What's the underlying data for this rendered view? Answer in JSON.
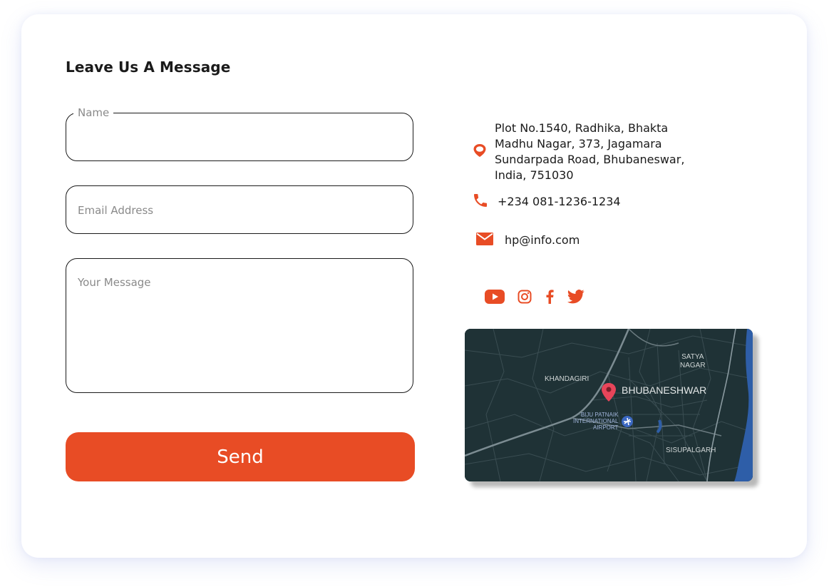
{
  "form": {
    "heading": "Leave Us A Message",
    "name_label": "Name",
    "name_value": "",
    "email_placeholder": "Email Address",
    "email_value": "",
    "message_placeholder": "Your Message",
    "message_value": "",
    "send_label": "Send"
  },
  "contact": {
    "address": "Plot No.1540, Radhika, Bhakta Madhu Nagar, 373, Jagamara Sundarpada Road, Bhubaneswar, India, 751030",
    "phone": "+234 081-1236-1234",
    "email": "hp@info.com"
  },
  "social": [
    "youtube-icon",
    "instagram-icon",
    "facebook-icon",
    "twitter-icon"
  ],
  "map": {
    "labels": {
      "city": "BHUBANESHWAR",
      "khandagiri": "KHANDAGIRI",
      "satya_nagar_line1": "SATYA",
      "satya_nagar_line2": "NAGAR",
      "airport_line1": "BIJU PATNAIK",
      "airport_line2": "INTERNATIONAL",
      "airport_line3": "AIRPORT",
      "sisupalgarh": "SISUPALGARH"
    }
  },
  "colors": {
    "accent": "#e84c25",
    "text": "#1a1a1a",
    "placeholder": "#8a8a8a",
    "map_bg": "#1f3236",
    "map_pin": "#e8455a",
    "map_water": "#2e5ea8"
  }
}
